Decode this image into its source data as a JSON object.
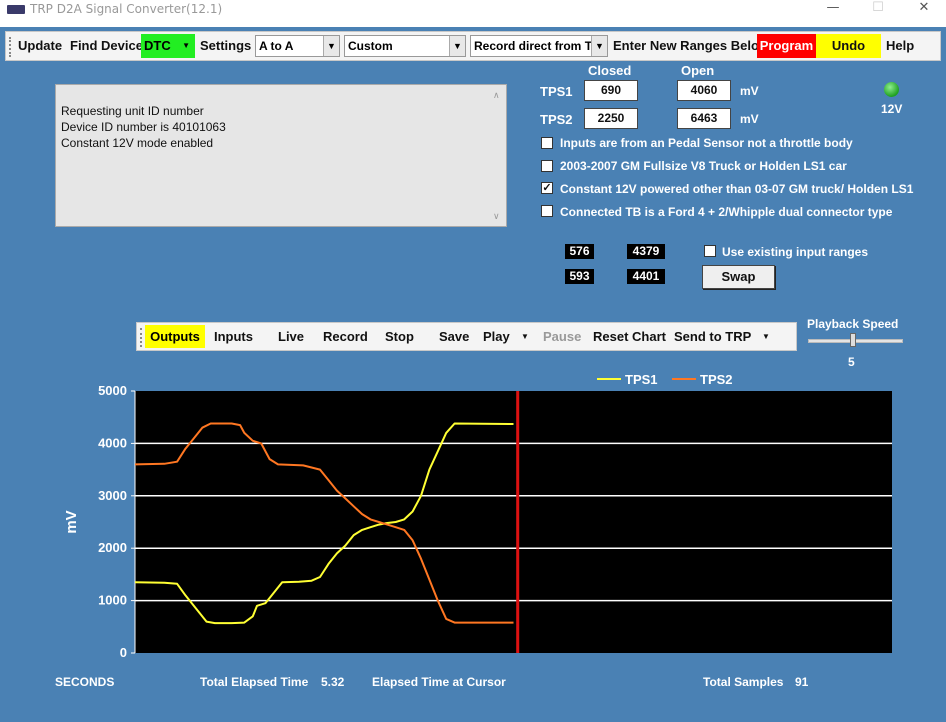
{
  "window": {
    "title": "TRP D2A Signal Converter(12.1)",
    "min": "—",
    "max": "☐",
    "close": "✕"
  },
  "toolbar": {
    "update": "Update",
    "find_device": "Find Device",
    "dtc": "DTC",
    "settings": "Settings",
    "mode_select": "A to A",
    "profile_select": "Custom",
    "record_select": "Record direct from T",
    "enter_ranges": "Enter New Ranges Below",
    "program": "Program",
    "undo": "Undo",
    "help": "Help"
  },
  "log": {
    "lines": [
      "Requesting unit ID number",
      "Device ID number is 40101063",
      "Constant 12V mode enabled"
    ]
  },
  "ranges": {
    "closed_label": "Closed",
    "open_label": "Open",
    "tps1_label": "TPS1",
    "tps2_label": "TPS2",
    "tps1_closed": "690",
    "tps1_open": "4060",
    "tps2_closed": "2250",
    "tps2_open": "6463",
    "unit1": "mV",
    "unit2": "mV"
  },
  "power": {
    "led_color": "#22aa22",
    "label": "12V"
  },
  "options": [
    {
      "label": "Inputs are from an Pedal Sensor not a throttle body",
      "checked": false
    },
    {
      "label": "2003-2007 GM Fullsize V8 Truck or Holden LS1 car",
      "checked": false
    },
    {
      "label": "Constant  12V powered other than 03-07 GM truck/ Holden LS1",
      "checked": true
    },
    {
      "label": "Connected TB is a Ford 4 + 2/Whipple dual connector type",
      "checked": false
    }
  ],
  "input_ranges": {
    "tps1_min": "576",
    "tps1_max": "4379",
    "tps2_min": "593",
    "tps2_max": "4401",
    "use_existing": "Use existing input ranges",
    "use_existing_checked": false,
    "swap": "Swap"
  },
  "chart_toolbar": {
    "outputs": "Outputs",
    "inputs": "Inputs",
    "live": "Live",
    "record": "Record",
    "stop": "Stop",
    "save": "Save",
    "play": "Play",
    "pause": "Pause",
    "reset_chart": "Reset Chart",
    "send_to_trp": "Send to TRP"
  },
  "playback": {
    "label": "Playback Speed",
    "value": "5"
  },
  "footer": {
    "seconds": "SECONDS",
    "total_elapsed_label": "Total Elapsed Time",
    "total_elapsed_value": "5.32",
    "elapsed_cursor_label": "Elapsed Time at Cursor",
    "total_samples_label": "Total Samples",
    "total_samples_value": "91"
  },
  "chart_data": {
    "type": "line",
    "ylabel": "mV",
    "ylim": [
      0,
      5000
    ],
    "yticks": [
      "0",
      "1000",
      "2000",
      "3000",
      "4000",
      "5000"
    ],
    "grid": true,
    "legend": "top",
    "background": "#000000",
    "cursor_sample": 91,
    "cursor_color": "#dd1111",
    "sample_count_max": 180,
    "series": [
      {
        "name": "TPS1",
        "color": "#ffff33",
        "points": [
          [
            0,
            1350
          ],
          [
            7,
            1340
          ],
          [
            10,
            1320
          ],
          [
            12,
            1100
          ],
          [
            15,
            800
          ],
          [
            17,
            600
          ],
          [
            19,
            570
          ],
          [
            23,
            570
          ],
          [
            26,
            580
          ],
          [
            28,
            700
          ],
          [
            29,
            900
          ],
          [
            31,
            950
          ],
          [
            33,
            1150
          ],
          [
            35,
            1350
          ],
          [
            39,
            1360
          ],
          [
            42,
            1380
          ],
          [
            44,
            1450
          ],
          [
            46,
            1700
          ],
          [
            48,
            1900
          ],
          [
            50,
            2050
          ],
          [
            52,
            2250
          ],
          [
            54,
            2350
          ],
          [
            56,
            2400
          ],
          [
            58,
            2450
          ],
          [
            60,
            2480
          ],
          [
            62,
            2500
          ],
          [
            64,
            2550
          ],
          [
            66,
            2700
          ],
          [
            68,
            3000
          ],
          [
            70,
            3500
          ],
          [
            72,
            3850
          ],
          [
            74,
            4200
          ],
          [
            76,
            4380
          ],
          [
            90,
            4370
          ]
        ]
      },
      {
        "name": "TPS2",
        "color": "#ff7722",
        "points": [
          [
            0,
            3600
          ],
          [
            7,
            3610
          ],
          [
            10,
            3650
          ],
          [
            12,
            3900
          ],
          [
            14,
            4100
          ],
          [
            16,
            4300
          ],
          [
            18,
            4380
          ],
          [
            23,
            4380
          ],
          [
            25,
            4350
          ],
          [
            26,
            4200
          ],
          [
            28,
            4050
          ],
          [
            30,
            4000
          ],
          [
            32,
            3700
          ],
          [
            34,
            3600
          ],
          [
            40,
            3580
          ],
          [
            44,
            3500
          ],
          [
            46,
            3300
          ],
          [
            48,
            3100
          ],
          [
            50,
            2950
          ],
          [
            52,
            2800
          ],
          [
            54,
            2650
          ],
          [
            56,
            2550
          ],
          [
            58,
            2500
          ],
          [
            60,
            2450
          ],
          [
            62,
            2400
          ],
          [
            64,
            2350
          ],
          [
            66,
            2150
          ],
          [
            68,
            1800
          ],
          [
            70,
            1400
          ],
          [
            72,
            1000
          ],
          [
            74,
            650
          ],
          [
            76,
            580
          ],
          [
            90,
            580
          ]
        ]
      }
    ]
  }
}
